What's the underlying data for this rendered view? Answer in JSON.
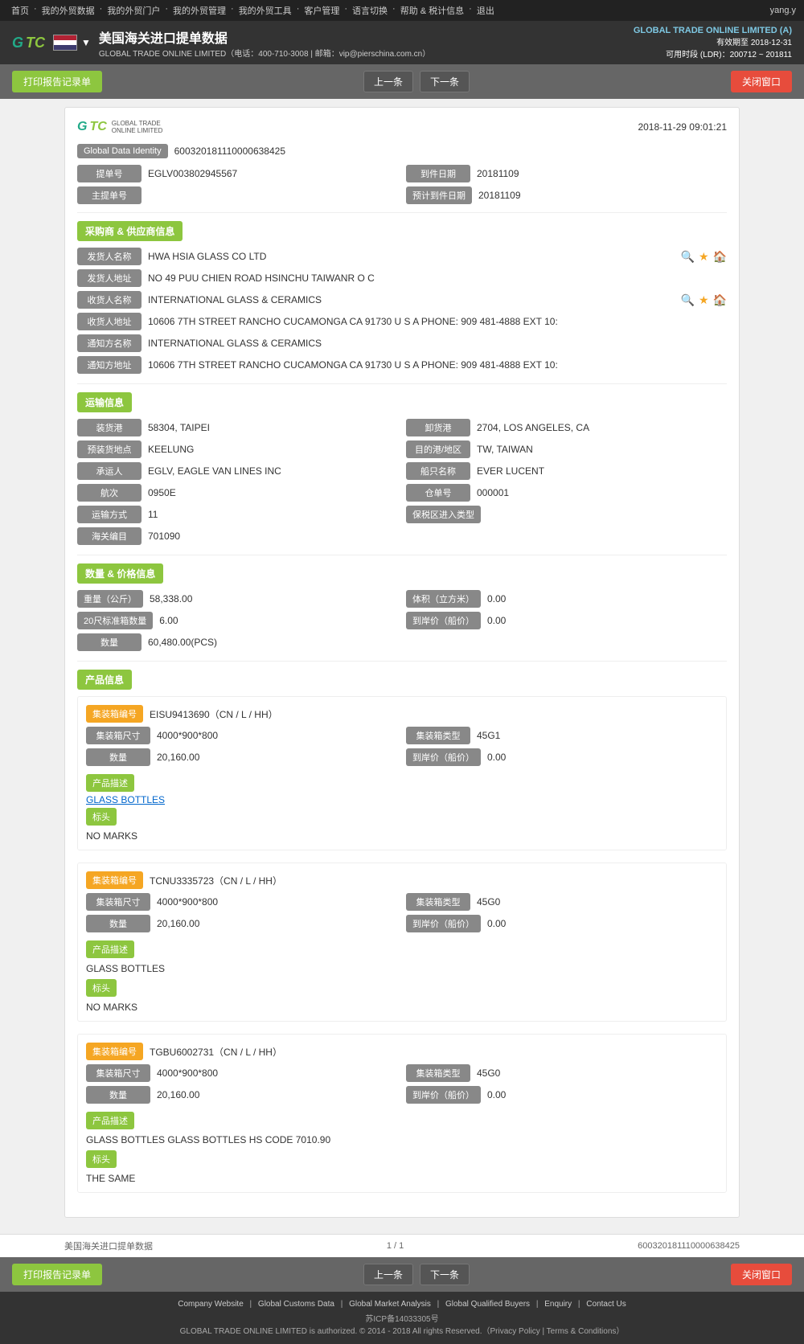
{
  "topNav": {
    "items": [
      "首页",
      "我的外贸数据",
      "我的外贸门户",
      "我的外贸管理",
      "我的外贸工具",
      "客户管理",
      "语言切换",
      "帮助 & 税计信息",
      "退出"
    ],
    "userLabel": "yang.y"
  },
  "header": {
    "companyName": "GLOBAL TRADE ONLINE LIMITED (A)",
    "validUntil": "有效期至 2018-12-31",
    "timeRange": "可用时段 (LDR)：200712 ~ 201811",
    "title": "美国海关进口提单数据",
    "subtitle": "GLOBAL TRADE ONLINE LIMITED（电话：400-710-3008 | 邮箱：vip@pierschina.com.cn）"
  },
  "actions": {
    "print": "打印报告记录单",
    "prev": "上一条",
    "next": "下一条",
    "close": "关闭窗口"
  },
  "record": {
    "datetime": "2018-11-29 09:01:21",
    "globalDataIdentityLabel": "Global Data Identity",
    "globalDataIdentity": "600320181110000638425",
    "billNoLabel": "提单号",
    "billNo": "EGLV003802945567",
    "departureDateLabel": "到件日期",
    "departureDate": "20181109",
    "masterBillLabel": "主提单号",
    "masterBillValue": "",
    "estimatedDateLabel": "预计到件日期",
    "estimatedDate": "20181109"
  },
  "buyerSupplier": {
    "sectionTitle": "采购商 & 供应商信息",
    "shipperNameLabel": "发货人名称",
    "shipperName": "HWA HSIA GLASS CO LTD",
    "shipperAddressLabel": "发货人地址",
    "shipperAddress": "NO 49 PUU CHIEN ROAD HSINCHU TAIWANR O C",
    "consigneeNameLabel": "收货人名称",
    "consigneeName": "INTERNATIONAL GLASS & CERAMICS",
    "consigneeAddressLabel": "收货人地址",
    "consigneeAddress": "10606 7TH STREET RANCHO CUCAMONGA CA 91730 U S A PHONE: 909 481-4888 EXT 10:",
    "notifyNameLabel": "通知方名称",
    "notifyName": "INTERNATIONAL GLASS & CERAMICS",
    "notifyAddressLabel": "通知方地址",
    "notifyAddress": "10606 7TH STREET RANCHO CUCAMONGA CA 91730 U S A PHONE: 909 481-4888 EXT 10:"
  },
  "transport": {
    "sectionTitle": "运输信息",
    "loadPortLabel": "装货港",
    "loadPort": "58304, TAIPEI",
    "dischargePortLabel": "卸货港",
    "dischargePort": "2704, LOS ANGELES, CA",
    "loadingPlaceLabel": "预装货地点",
    "loadingPlace": "KEELUNG",
    "destinationLabel": "目的港/地区",
    "destination": "TW, TAIWAN",
    "carrierLabel": "承运人",
    "carrier": "EGLV, EAGLE VAN LINES INC",
    "vesselLabel": "船只名称",
    "vessel": "EVER LUCENT",
    "voyageLabel": "航次",
    "voyage": "0950E",
    "warehouseNoLabel": "仓单号",
    "warehouseNo": "000001",
    "transportModeLabel": "运输方式",
    "transportMode": "11",
    "insuranceModeLabel": "保税区进入类型",
    "insuranceMode": "",
    "customsCodeLabel": "海关编目",
    "customsCode": "701090"
  },
  "quantityPrice": {
    "sectionTitle": "数量 & 价格信息",
    "weightLabel": "重量（公斤）",
    "weight": "58,338.00",
    "volumeLabel": "体积（立方米）",
    "volume": "0.00",
    "container20Label": "20尺标准箱数量",
    "container20": "6.00",
    "declaredPriceLabel": "到岸价（船价）",
    "declaredPrice": "0.00",
    "quantityLabel": "数量",
    "quantity": "60,480.00(PCS)"
  },
  "products": {
    "sectionTitle": "产品信息",
    "items": [
      {
        "containerNoLabel": "集装箱编号",
        "containerNo": "EISU9413690（CN / L / HH）",
        "sizeLabel": "集装箱尺寸",
        "size": "4000*900*800",
        "typeLabel": "集装箱类型",
        "type": "45G1",
        "quantityLabel": "数量",
        "quantity": "20,160.00",
        "declaredPriceLabel": "到岸价（船价）",
        "declaredPrice": "0.00",
        "descTitle": "产品描述",
        "descLink": "GLASS BOTTLES",
        "marksTitle": "标头",
        "marks": "NO MARKS"
      },
      {
        "containerNoLabel": "集装箱编号",
        "containerNo": "TCNU3335723（CN / L / HH）",
        "sizeLabel": "集装箱尺寸",
        "size": "4000*900*800",
        "typeLabel": "集装箱类型",
        "type": "45G0",
        "quantityLabel": "数量",
        "quantity": "20,160.00",
        "declaredPriceLabel": "到岸价（船价）",
        "declaredPrice": "0.00",
        "descTitle": "产品描述",
        "descLink": "",
        "descText": "GLASS BOTTLES",
        "marksTitle": "标头",
        "marks": "NO MARKS"
      },
      {
        "containerNoLabel": "集装箱编号",
        "containerNo": "TGBU6002731（CN / L / HH）",
        "sizeLabel": "集装箱尺寸",
        "size": "4000*900*800",
        "typeLabel": "集装箱类型",
        "type": "45G0",
        "quantityLabel": "数量",
        "quantity": "20,160.00",
        "declaredPriceLabel": "到岸价（船价）",
        "declaredPrice": "0.00",
        "descTitle": "产品描述",
        "descLink": "",
        "descText": "GLASS BOTTLES GLASS BOTTLES HS CODE 7010.90",
        "marksTitle": "标头",
        "marks": "THE SAME"
      }
    ]
  },
  "pageFooter": {
    "label": "美国海关进口提单数据",
    "pageInfo": "1 / 1",
    "recordId": "600320181110000638425"
  },
  "siteFooter": {
    "links": [
      "Company Website",
      "Global Customs Data",
      "Global Market Analysis",
      "Global Qualified Buyers",
      "Enquiry",
      "Contact Us"
    ],
    "icp": "苏ICP备14033305号",
    "copyright": "GLOBAL TRADE ONLINE LIMITED is authorized. © 2014 - 2018 All rights Reserved.（Privacy Policy | Terms & Conditions）"
  }
}
